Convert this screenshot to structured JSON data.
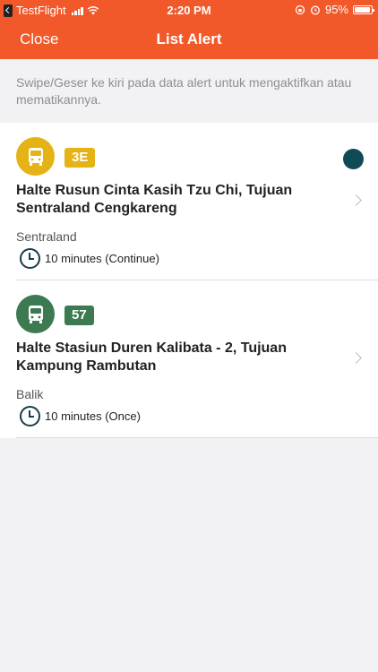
{
  "status_bar": {
    "carrier": "TestFlight",
    "time": "2:20 PM",
    "battery": "95%"
  },
  "nav": {
    "close_label": "Close",
    "title": "List Alert"
  },
  "hint": "Swipe/Geser ke kiri pada data alert untuk mengaktifkan atau mematikannya.",
  "alerts": [
    {
      "route": "3E",
      "route_color": "#e5b316",
      "stop": "Halte Rusun Cinta Kasih Tzu Chi, Tujuan Sentraland Cengkareng",
      "direction": "Sentraland",
      "schedule": "10 minutes (Continue)",
      "active": true,
      "status_color": "#0f4a55"
    },
    {
      "route": "57",
      "route_color": "#3c7a52",
      "stop": "Halte Stasiun Duren Kalibata - 2, Tujuan Kampung Rambutan",
      "direction": "Balik",
      "schedule": "10 minutes (Once)",
      "active": false
    }
  ]
}
